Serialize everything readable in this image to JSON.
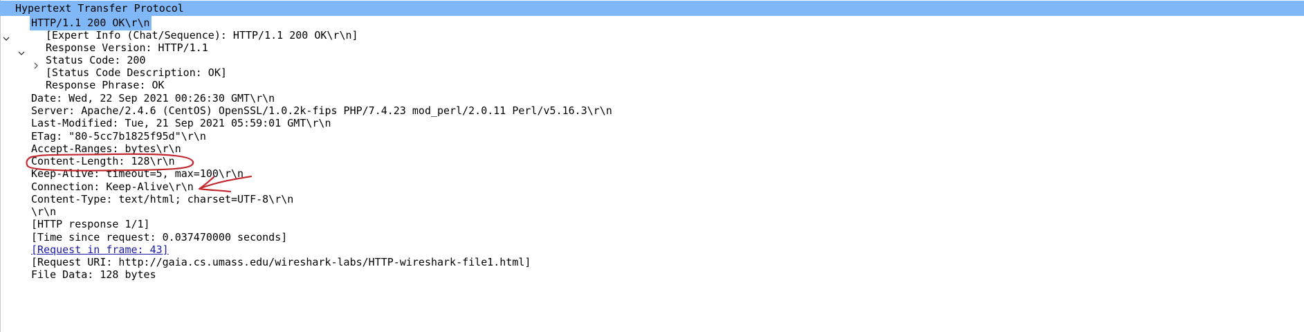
{
  "protocol_tree": {
    "root": "Hypertext Transfer Protocol",
    "status_line": "HTTP/1.1 200 OK\\r\\n",
    "status_children": [
      "[Expert Info (Chat/Sequence): HTTP/1.1 200 OK\\r\\n]",
      "Response Version: HTTP/1.1",
      "Status Code: 200",
      "[Status Code Description: OK]",
      "Response Phrase: OK"
    ],
    "headers": [
      "Date: Wed, 22 Sep 2021 00:26:30 GMT\\r\\n",
      "Server: Apache/2.4.6 (CentOS) OpenSSL/1.0.2k-fips PHP/7.4.23 mod_perl/2.0.11 Perl/v5.16.3\\r\\n",
      "Last-Modified: Tue, 21 Sep 2021 05:59:01 GMT\\r\\n",
      "ETag: \"80-5cc7b1825f95d\"\\r\\n",
      "Accept-Ranges: bytes\\r\\n",
      "Content-Length: 128\\r\\n",
      "Keep-Alive: timeout=5, max=100\\r\\n",
      "Connection: Keep-Alive\\r\\n",
      "Content-Type: text/html; charset=UTF-8\\r\\n",
      "\\r\\n",
      "[HTTP response 1/1]",
      "[Time since request: 0.037470000 seconds]",
      "[Request in frame: 43]",
      "[Request URI: http://gaia.cs.umass.edu/wireshark-labs/HTTP-wireshark-file1.html]",
      "File Data: 128 bytes"
    ]
  },
  "colors": {
    "selection": "#80b7f6",
    "link": "#1a1aa6",
    "annotation_ink": "#c0282d"
  },
  "icons": {
    "expanded": "chevron-down-icon",
    "collapsed": "chevron-right-icon"
  }
}
